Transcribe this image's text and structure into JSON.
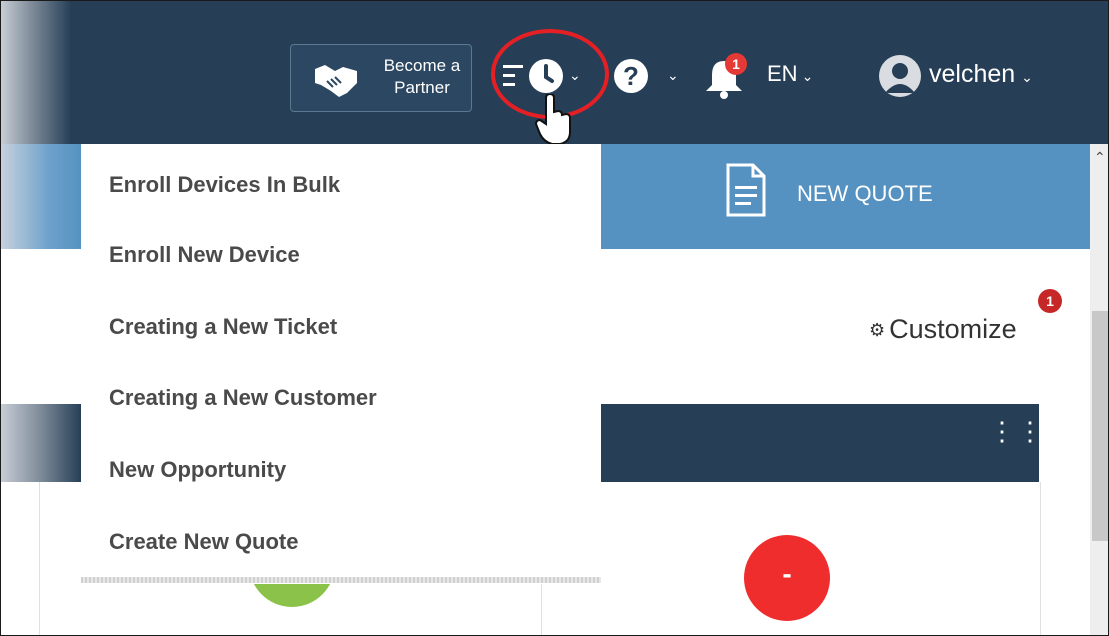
{
  "header": {
    "partner_button": {
      "line1": "Become a",
      "line2": "Partner"
    },
    "recent_actions_icon": "clock-icon",
    "help_icon": "question-icon",
    "notifications": {
      "icon": "bell-icon",
      "badge": "1"
    },
    "language": "EN",
    "user": {
      "name": "velchen",
      "avatar_icon": "user-avatar-icon"
    }
  },
  "recent_actions_menu": {
    "items": [
      {
        "label": "Enroll Devices In Bulk"
      },
      {
        "label": "Enroll New Device"
      },
      {
        "label": "Creating a New Ticket"
      },
      {
        "label": "Creating a New Customer"
      },
      {
        "label": "New Opportunity"
      },
      {
        "label": "Create New Quote"
      }
    ]
  },
  "quick_action": {
    "label": "NEW QUOTE",
    "icon": "document-icon"
  },
  "customize": {
    "label": "Customize",
    "icon": "gears-icon",
    "badge": "1"
  },
  "widget": {
    "menu_icon": "vertical-dots-icon",
    "status_red": "-"
  },
  "colors": {
    "header_bg": "#263f57",
    "quick_action_bg": "#5592c1",
    "highlight_ring": "#e52025",
    "badge": "#e53935"
  }
}
